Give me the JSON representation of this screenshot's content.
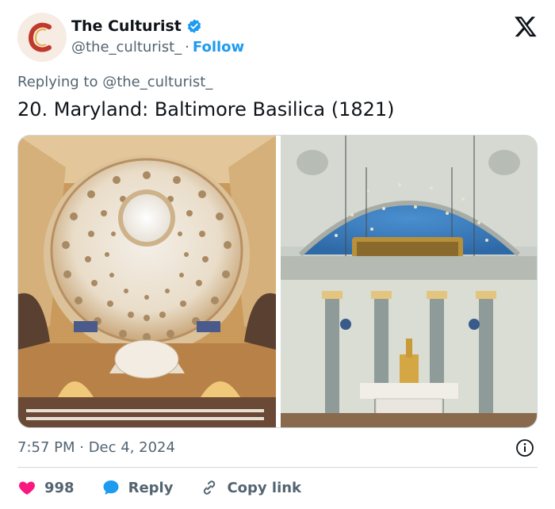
{
  "author": {
    "name": "The Culturist",
    "handle": "@the_culturist_",
    "separator": "·",
    "follow_label": "Follow",
    "verified": true,
    "avatar_icon": "culturist-logo-icon"
  },
  "platform_icon": "x-logo-icon",
  "replying_to": "Replying to @the_culturist_",
  "text": "20. Maryland: Baltimore Basilica (1821)",
  "media": {
    "images": [
      {
        "description_icon": "basilica-dome-photo"
      },
      {
        "description_icon": "basilica-altar-photo"
      }
    ]
  },
  "timestamp": "7:57 PM · Dec 4, 2024",
  "actions": {
    "likes": "998",
    "reply_label": "Reply",
    "copy_label": "Copy link"
  },
  "colors": {
    "accent": "#1d9bf0",
    "like": "#f91880",
    "text": "#0f1419",
    "muted": "#536471"
  }
}
